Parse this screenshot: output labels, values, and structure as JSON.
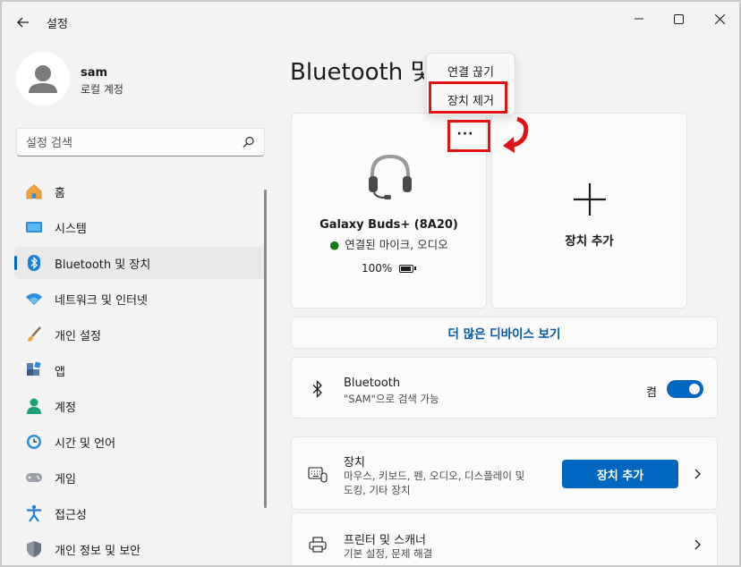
{
  "window": {
    "title": "설정"
  },
  "user": {
    "name": "sam",
    "account_type": "로컬 계정"
  },
  "search": {
    "placeholder": "설정 검색"
  },
  "sidebar": {
    "items": [
      {
        "label": "홈",
        "icon": "home-icon"
      },
      {
        "label": "시스템",
        "icon": "system-icon"
      },
      {
        "label": "Bluetooth 및 장치",
        "icon": "bluetooth-icon",
        "selected": true
      },
      {
        "label": "네트워크 및 인터넷",
        "icon": "wifi-icon"
      },
      {
        "label": "개인 설정",
        "icon": "brush-icon"
      },
      {
        "label": "앱",
        "icon": "apps-icon"
      },
      {
        "label": "계정",
        "icon": "account-icon"
      },
      {
        "label": "시간 및 언어",
        "icon": "clock-icon"
      },
      {
        "label": "게임",
        "icon": "gamepad-icon"
      },
      {
        "label": "접근성",
        "icon": "accessibility-icon"
      },
      {
        "label": "개인 정보 및 보안",
        "icon": "shield-icon"
      }
    ]
  },
  "main": {
    "title": "Bluetooth 및 장치",
    "device_card": {
      "name": "Galaxy Buds+ (8A20)",
      "status": "연결된 마이크, 오디오",
      "battery": "100%",
      "battery_level": 1.0,
      "more_label": "···"
    },
    "add_card": {
      "label": "장치 추가"
    },
    "more_devices": {
      "label": "더 많은 디바이스 보기"
    },
    "bluetooth_row": {
      "title": "Bluetooth",
      "subtitle": "\"SAM\"으로 검색 가능",
      "toggle_label": "켬",
      "toggle_on": true
    },
    "devices_row": {
      "title": "장치",
      "subtitle_line1": "마우스, 키보드, 펜, 오디오, 디스플레이 및",
      "subtitle_line2": "도킹, 기타 장치",
      "button_label": "장치 추가"
    },
    "printers_row": {
      "title": "프린터 및 스캐너",
      "subtitle": "기본 설정, 문제 해결"
    }
  },
  "context_menu": {
    "items": [
      {
        "label": "연결 끊기"
      },
      {
        "label": "장치 제거",
        "highlighted": true
      }
    ]
  },
  "colors": {
    "accent": "#0067c0",
    "highlight": "#e21212",
    "connected": "#0f7b0f"
  }
}
